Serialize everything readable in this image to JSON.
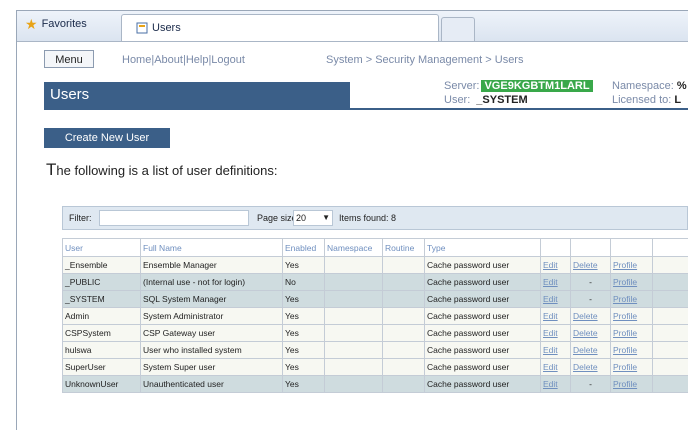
{
  "browser": {
    "favorites_label": "Favorites",
    "tab_title": "Users"
  },
  "header": {
    "menu_label": "Menu",
    "links": [
      "Home",
      "About",
      "Help",
      "Logout"
    ],
    "breadcrumb": "System > Security Management > Users",
    "title": "Users",
    "server_label": "Server:",
    "server_value": "VGE9KGBTM1LARL",
    "namespace_label": "Namespace:",
    "namespace_value": "%",
    "user_label": "User:",
    "user_value": "_SYSTEM",
    "licensed_label": "Licensed to:",
    "licensed_value": "L"
  },
  "content": {
    "create_button": "Create New User",
    "intro_first": "T",
    "intro_rest": "he following is a list of user definitions:"
  },
  "filter": {
    "filter_label": "Filter:",
    "filter_value": "",
    "page_size_label": "Page size:",
    "page_size_value": "20",
    "items_found_label": "Items found: 8"
  },
  "table": {
    "headers": [
      "User",
      "Full Name",
      "Enabled",
      "Namespace",
      "Routine",
      "Type",
      "",
      "",
      ""
    ],
    "rows": [
      {
        "user": "_Ensemble",
        "full_name": "Ensemble Manager",
        "enabled": "Yes",
        "namespace": "",
        "routine": "",
        "type": "Cache password user",
        "edit": "Edit",
        "delete": "Delete",
        "profile": "Profile"
      },
      {
        "user": "_PUBLIC",
        "full_name": "(Internal use - not for login)",
        "enabled": "No",
        "namespace": "",
        "routine": "",
        "type": "Cache password user",
        "edit": "Edit",
        "delete": "-",
        "profile": "Profile"
      },
      {
        "user": "_SYSTEM",
        "full_name": "SQL System Manager",
        "enabled": "Yes",
        "namespace": "",
        "routine": "",
        "type": "Cache password user",
        "edit": "Edit",
        "delete": "-",
        "profile": "Profile"
      },
      {
        "user": "Admin",
        "full_name": "System Administrator",
        "enabled": "Yes",
        "namespace": "",
        "routine": "",
        "type": "Cache password user",
        "edit": "Edit",
        "delete": "Delete",
        "profile": "Profile"
      },
      {
        "user": "CSPSystem",
        "full_name": "CSP Gateway user",
        "enabled": "Yes",
        "namespace": "",
        "routine": "",
        "type": "Cache password user",
        "edit": "Edit",
        "delete": "Delete",
        "profile": "Profile"
      },
      {
        "user": "hulswa",
        "full_name": "User who installed system",
        "enabled": "Yes",
        "namespace": "",
        "routine": "",
        "type": "Cache password user",
        "edit": "Edit",
        "delete": "Delete",
        "profile": "Profile"
      },
      {
        "user": "SuperUser",
        "full_name": "System Super user",
        "enabled": "Yes",
        "namespace": "",
        "routine": "",
        "type": "Cache password user",
        "edit": "Edit",
        "delete": "Delete",
        "profile": "Profile"
      },
      {
        "user": "UnknownUser",
        "full_name": "Unauthenticated user",
        "enabled": "Yes",
        "namespace": "",
        "routine": "",
        "type": "Cache password user",
        "edit": "Edit",
        "delete": "-",
        "profile": "Profile"
      }
    ]
  },
  "colors": {
    "title_bar": "#3b5f88",
    "server_badge": "#39a84a",
    "row_alt": "#cfdcdf",
    "link": "#6f8fbf"
  },
  "icons": [
    "star-icon",
    "page-icon",
    "dropdown-arrow-icon"
  ]
}
